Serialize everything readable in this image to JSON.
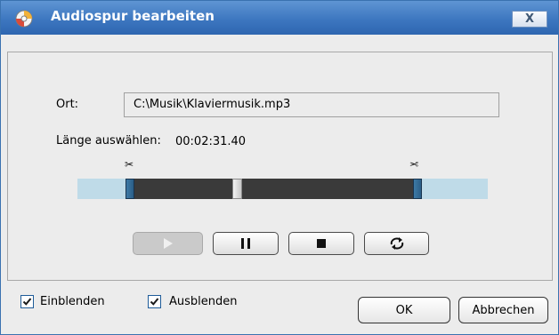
{
  "window": {
    "title": "Audiospur bearbeiten",
    "close_label": "X"
  },
  "location": {
    "label": "Ort:",
    "value": "C:\\Musik\\Klaviermusik.mp3"
  },
  "length": {
    "label": "Länge auswählen:",
    "value": "00:02:31.40"
  },
  "playback": {
    "play_enabled": false
  },
  "options": {
    "fade_in": {
      "label": "Einblenden",
      "checked": true
    },
    "fade_out": {
      "label": "Ausblenden",
      "checked": true
    }
  },
  "buttons": {
    "ok": "OK",
    "cancel": "Abbrechen"
  },
  "colors": {
    "titlebar": "#3d77c0",
    "track_background": "#bfdbe8",
    "selection": "#3a3a3a",
    "handle": "#2b5e87"
  }
}
